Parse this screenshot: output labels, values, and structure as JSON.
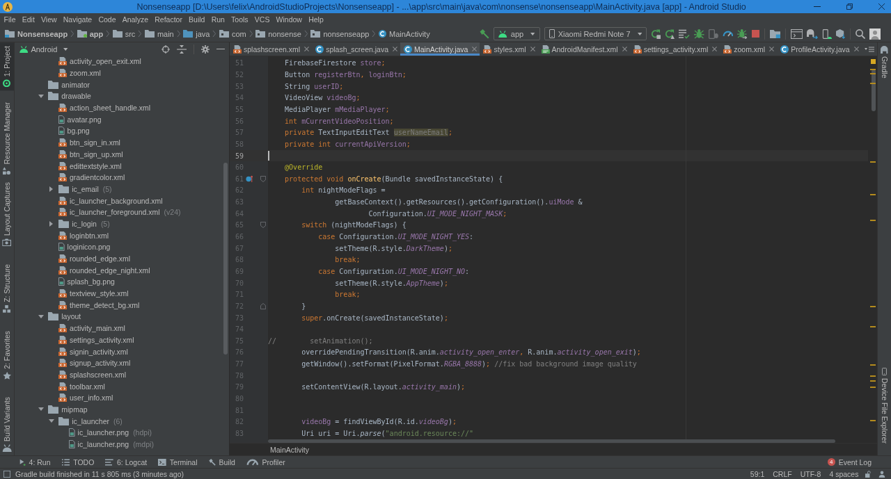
{
  "window": {
    "title": "Nonsenseapp [D:\\Users\\felix\\AndroidStudioProjects\\Nonsenseapp] - ...\\app\\src\\main\\java\\com\\nonsense\\nonsenseapp\\MainActivity.java [app] - Android Studio"
  },
  "menu": [
    "File",
    "Edit",
    "View",
    "Navigate",
    "Code",
    "Analyze",
    "Refactor",
    "Build",
    "Run",
    "Tools",
    "VCS",
    "Window",
    "Help"
  ],
  "breadcrumbs": [
    {
      "label": "Nonsenseapp",
      "kind": "project"
    },
    {
      "label": "app",
      "kind": "module"
    },
    {
      "label": "src",
      "kind": "folder"
    },
    {
      "label": "main",
      "kind": "folder"
    },
    {
      "label": "java",
      "kind": "source_folder"
    },
    {
      "label": "com",
      "kind": "package"
    },
    {
      "label": "nonsense",
      "kind": "package"
    },
    {
      "label": "nonsenseapp",
      "kind": "package"
    },
    {
      "label": "MainActivity",
      "kind": "class"
    }
  ],
  "toolbar": {
    "run_config": "app",
    "device": "Xiaomi Redmi Note 7"
  },
  "left_strip": {
    "top": [
      {
        "label": "1: Project",
        "kind": "project",
        "selected": true
      },
      {
        "label": "Resource Manager",
        "kind": "resources",
        "selected": false
      }
    ],
    "bottom": [
      {
        "label": "Layout Captures",
        "kind": "captures",
        "selected": false
      },
      {
        "label": "Z: Structure",
        "kind": "structure",
        "selected": false
      },
      {
        "label": "2: Favorites",
        "kind": "favorites",
        "selected": false
      },
      {
        "label": "Build Variants",
        "kind": "variants",
        "selected": false
      }
    ]
  },
  "project_panel": {
    "view": "Android",
    "tree": [
      {
        "children": [
          {
            "label": "activity_open_exit.xml",
            "kind": "xml"
          },
          {
            "label": "zoom.xml",
            "kind": "xml"
          }
        ]
      },
      {
        "label": "animator",
        "kind": "folder"
      },
      {
        "label": "drawable",
        "kind": "folder",
        "expanded": true,
        "children": [
          {
            "label": "action_sheet_handle.xml",
            "kind": "xml"
          },
          {
            "label": "avatar.png",
            "kind": "image"
          },
          {
            "label": "bg.png",
            "kind": "image"
          },
          {
            "label": "btn_sign_in.xml",
            "kind": "xml"
          },
          {
            "label": "btn_sign_up.xml",
            "kind": "xml"
          },
          {
            "label": "edittextstyle.xml",
            "kind": "xml"
          },
          {
            "label": "gradientcolor.xml",
            "kind": "xml"
          },
          {
            "label": "ic_email",
            "kind": "folder",
            "expanded": false,
            "note": "(5)"
          },
          {
            "label": "ic_launcher_background.xml",
            "kind": "xml"
          },
          {
            "label": "ic_launcher_foreground.xml",
            "kind": "xml",
            "note": "(v24)"
          },
          {
            "label": "ic_login",
            "kind": "folder",
            "expanded": false,
            "note": "(5)"
          },
          {
            "label": "loginbtn.xml",
            "kind": "xml"
          },
          {
            "label": "loginicon.png",
            "kind": "image"
          },
          {
            "label": "rounded_edge.xml",
            "kind": "xml"
          },
          {
            "label": "rounded_edge_night.xml",
            "kind": "xml"
          },
          {
            "label": "splash_bg.png",
            "kind": "image"
          },
          {
            "label": "textview_style.xml",
            "kind": "xml"
          },
          {
            "label": "theme_detect_bg.xml",
            "kind": "xml"
          }
        ]
      },
      {
        "label": "layout",
        "kind": "folder",
        "expanded": true,
        "children": [
          {
            "label": "activity_main.xml",
            "kind": "xml"
          },
          {
            "label": "settings_activity.xml",
            "kind": "xml"
          },
          {
            "label": "signin_activity.xml",
            "kind": "xml"
          },
          {
            "label": "signup_activity.xml",
            "kind": "xml"
          },
          {
            "label": "splashscreen.xml",
            "kind": "xml"
          },
          {
            "label": "toolbar.xml",
            "kind": "xml"
          },
          {
            "label": "user_info.xml",
            "kind": "xml"
          }
        ]
      },
      {
        "label": "mipmap",
        "kind": "folder",
        "expanded": true,
        "children": [
          {
            "label": "ic_launcher",
            "kind": "folder",
            "expanded": true,
            "note": "(6)",
            "children": [
              {
                "label": "ic_launcher.png",
                "kind": "image",
                "note": "(hdpi)"
              },
              {
                "label": "ic_launcher.png",
                "kind": "image",
                "note": "(mdpi)"
              }
            ]
          }
        ]
      }
    ]
  },
  "editor": {
    "tabs": [
      {
        "label": "splashscreen.xml",
        "kind": "xml",
        "selected": false
      },
      {
        "label": "splash_screen.java",
        "kind": "class",
        "selected": false
      },
      {
        "label": "MainActivity.java",
        "kind": "class",
        "selected": true
      },
      {
        "label": "styles.xml",
        "kind": "xml",
        "selected": false
      },
      {
        "label": "AndroidManifest.xml",
        "kind": "manifest",
        "selected": false
      },
      {
        "label": "settings_activity.xml",
        "kind": "xml",
        "selected": false
      },
      {
        "label": "zoom.xml",
        "kind": "xml",
        "selected": false
      },
      {
        "label": "ProfileActivity.java",
        "kind": "class",
        "selected": false
      }
    ],
    "lines": [
      {
        "number": "51",
        "current": false,
        "tokens": [
          {
            "text": "    FirebaseFirestore ",
            "kind": "plain"
          },
          {
            "text": "store",
            "kind": "field"
          },
          {
            "text": ";",
            "kind": "punct"
          }
        ]
      },
      {
        "number": "52",
        "current": false,
        "tokens": [
          {
            "text": "    Button ",
            "kind": "plain"
          },
          {
            "text": "registerBtn",
            "kind": "field"
          },
          {
            "text": ", ",
            "kind": "punct"
          },
          {
            "text": "loginBtn",
            "kind": "field"
          },
          {
            "text": ";",
            "kind": "punct"
          }
        ]
      },
      {
        "number": "53",
        "current": false,
        "tokens": [
          {
            "text": "    String ",
            "kind": "plain"
          },
          {
            "text": "userID",
            "kind": "field"
          },
          {
            "text": ";",
            "kind": "punct"
          }
        ]
      },
      {
        "number": "54",
        "current": false,
        "tokens": [
          {
            "text": "    VideoView ",
            "kind": "plain"
          },
          {
            "text": "videoBg",
            "kind": "field"
          },
          {
            "text": ";",
            "kind": "punct"
          }
        ]
      },
      {
        "number": "55",
        "current": false,
        "tokens": [
          {
            "text": "    MediaPlayer ",
            "kind": "plain"
          },
          {
            "text": "mMediaPlayer",
            "kind": "field"
          },
          {
            "text": ";",
            "kind": "punct"
          }
        ]
      },
      {
        "number": "56",
        "current": false,
        "tokens": [
          {
            "text": "    int ",
            "kind": "keyword"
          },
          {
            "text": "mCurrentVideoPosition",
            "kind": "field"
          },
          {
            "text": ";",
            "kind": "punct"
          }
        ]
      },
      {
        "number": "57",
        "current": false,
        "tokens": [
          {
            "text": "    private ",
            "kind": "keyword"
          },
          {
            "text": "TextInputEditText ",
            "kind": "plain"
          },
          {
            "text": "userNameEmail",
            "kind": "unused"
          },
          {
            "text": ";",
            "kind": "punct"
          }
        ]
      },
      {
        "number": "58",
        "current": false,
        "tokens": [
          {
            "text": "    private int ",
            "kind": "keyword"
          },
          {
            "text": "currentApiVersion",
            "kind": "field"
          },
          {
            "text": ";",
            "kind": "punct"
          }
        ]
      },
      {
        "number": "59",
        "current": true
      },
      {
        "number": "60",
        "current": false,
        "tokens": [
          {
            "text": "    @Override",
            "kind": "annotation"
          }
        ]
      },
      {
        "number": "61",
        "current": false,
        "gutter": [
          {
            "kind": "override"
          },
          {
            "kind": "fold_start"
          }
        ],
        "tokens": [
          {
            "text": "    protected void ",
            "kind": "keyword"
          },
          {
            "text": "onCreate",
            "kind": "method"
          },
          {
            "text": "(Bundle savedInstanceState) {",
            "kind": "plain"
          }
        ]
      },
      {
        "number": "62",
        "current": false,
        "tokens": [
          {
            "text": "        int ",
            "kind": "keyword"
          },
          {
            "text": "nightModeFlags =",
            "kind": "plain"
          }
        ]
      },
      {
        "number": "63",
        "current": false,
        "tokens": [
          {
            "text": "                getBaseContext().getResources().getConfiguration().",
            "kind": "plain"
          },
          {
            "text": "uiMode",
            "kind": "field"
          },
          {
            "text": " &",
            "kind": "plain"
          }
        ]
      },
      {
        "number": "64",
        "current": false,
        "tokens": [
          {
            "text": "                        Configuration.",
            "kind": "plain"
          },
          {
            "text": "UI_MODE_NIGHT_MASK",
            "kind": "static"
          },
          {
            "text": ";",
            "kind": "punct"
          }
        ]
      },
      {
        "number": "65",
        "current": false,
        "gutter": [
          {
            "kind": "fold_start"
          }
        ],
        "tokens": [
          {
            "text": "        switch ",
            "kind": "keyword"
          },
          {
            "text": "(nightModeFlags) {",
            "kind": "plain"
          }
        ]
      },
      {
        "number": "66",
        "current": false,
        "tokens": [
          {
            "text": "            case ",
            "kind": "keyword"
          },
          {
            "text": "Configuration.",
            "kind": "plain"
          },
          {
            "text": "UI_MODE_NIGHT_YES",
            "kind": "static"
          },
          {
            "text": ":",
            "kind": "plain"
          }
        ]
      },
      {
        "number": "67",
        "current": false,
        "tokens": [
          {
            "text": "                setTheme(R.style.",
            "kind": "plain"
          },
          {
            "text": "DarkTheme",
            "kind": "static"
          },
          {
            "text": ")",
            "kind": "plain"
          },
          {
            "text": ";",
            "kind": "punct"
          }
        ]
      },
      {
        "number": "68",
        "current": false,
        "tokens": [
          {
            "text": "                break;",
            "kind": "keyword"
          }
        ]
      },
      {
        "number": "69",
        "current": false,
        "tokens": [
          {
            "text": "            case ",
            "kind": "keyword"
          },
          {
            "text": "Configuration.",
            "kind": "plain"
          },
          {
            "text": "UI_MODE_NIGHT_NO",
            "kind": "static"
          },
          {
            "text": ":",
            "kind": "plain"
          }
        ]
      },
      {
        "number": "70",
        "current": false,
        "tokens": [
          {
            "text": "                setTheme(R.style.",
            "kind": "plain"
          },
          {
            "text": "AppTheme",
            "kind": "static"
          },
          {
            "text": ")",
            "kind": "plain"
          },
          {
            "text": ";",
            "kind": "punct"
          }
        ]
      },
      {
        "number": "71",
        "current": false,
        "tokens": [
          {
            "text": "                break;",
            "kind": "keyword"
          }
        ]
      },
      {
        "number": "72",
        "current": false,
        "gutter": [
          {
            "kind": "fold_end"
          }
        ],
        "tokens": [
          {
            "text": "        }",
            "kind": "plain"
          }
        ]
      },
      {
        "number": "73",
        "current": false,
        "tokens": [
          {
            "text": "        super",
            "kind": "keyword"
          },
          {
            "text": ".onCreate(savedInstanceState)",
            "kind": "plain"
          },
          {
            "text": ";",
            "kind": "punct"
          }
        ]
      },
      {
        "number": "74",
        "current": false
      },
      {
        "number": "75",
        "current": false,
        "tokens": [
          {
            "text": "//        setAnimation();",
            "kind": "comment"
          }
        ]
      },
      {
        "number": "76",
        "current": false,
        "tokens": [
          {
            "text": "        overridePendingTransition(R.anim.",
            "kind": "plain"
          },
          {
            "text": "activity_open_enter",
            "kind": "static"
          },
          {
            "text": ", ",
            "kind": "punct"
          },
          {
            "text": "R.anim.",
            "kind": "plain"
          },
          {
            "text": "activity_open_exit",
            "kind": "static"
          },
          {
            "text": ")",
            "kind": "plain"
          },
          {
            "text": ";",
            "kind": "punct"
          }
        ]
      },
      {
        "number": "77",
        "current": false,
        "tokens": [
          {
            "text": "        getWindow().setFormat(PixelFormat.",
            "kind": "plain"
          },
          {
            "text": "RGBA_8888",
            "kind": "static"
          },
          {
            "text": ")",
            "kind": "plain"
          },
          {
            "text": "; ",
            "kind": "punct"
          },
          {
            "text": "//fix bad background image quality",
            "kind": "comment"
          }
        ]
      },
      {
        "number": "78",
        "current": false
      },
      {
        "number": "79",
        "current": false,
        "tokens": [
          {
            "text": "        setContentView(R.layout.",
            "kind": "plain"
          },
          {
            "text": "activity_main",
            "kind": "static"
          },
          {
            "text": ")",
            "kind": "plain"
          },
          {
            "text": ";",
            "kind": "punct"
          }
        ]
      },
      {
        "number": "80",
        "current": false
      },
      {
        "number": "81",
        "current": false
      },
      {
        "number": "82",
        "current": false,
        "tokens": [
          {
            "text": "        videoBg",
            "kind": "field"
          },
          {
            "text": " = findViewById(R.id.",
            "kind": "plain"
          },
          {
            "text": "videoBg",
            "kind": "static"
          },
          {
            "text": ")",
            "kind": "plain"
          },
          {
            "text": ";",
            "kind": "punct"
          }
        ]
      },
      {
        "number": "83",
        "current": false,
        "tokens": [
          {
            "text": "        Uri uri = Uri.",
            "kind": "plain"
          },
          {
            "text": "parse",
            "kind": "static_call"
          },
          {
            "text": "(",
            "kind": "plain"
          },
          {
            "text": "\"android.resource://\"",
            "kind": "string"
          }
        ]
      }
    ],
    "breadcrumb": "MainActivity"
  },
  "right_strip": {
    "top": [
      {
        "label": "Gradle",
        "kind": "gradle",
        "selected": false
      }
    ],
    "bottom": [
      {
        "label": "Device File Explorer",
        "kind": "device",
        "selected": false
      }
    ]
  },
  "tool_windows": [
    {
      "label": "4: Run",
      "kind": "run",
      "selected": false
    },
    {
      "label": "TODO",
      "kind": "todo",
      "selected": false
    },
    {
      "label": "6: Logcat",
      "kind": "logcat",
      "selected": false
    },
    {
      "label": "Terminal",
      "kind": "terminal",
      "selected": false
    },
    {
      "label": "Build",
      "kind": "build",
      "selected": false
    },
    {
      "label": "Profiler",
      "kind": "profiler",
      "selected": false
    }
  ],
  "event_log": {
    "label": "Event Log",
    "count": "4",
    "selected": false
  },
  "status_bar": {
    "message": "Gradle build finished in 11 s 805 ms (3 minutes ago)",
    "position": "59:1",
    "line_separator": "CRLF",
    "encoding": "UTF-8",
    "indent": "4 spaces"
  }
}
